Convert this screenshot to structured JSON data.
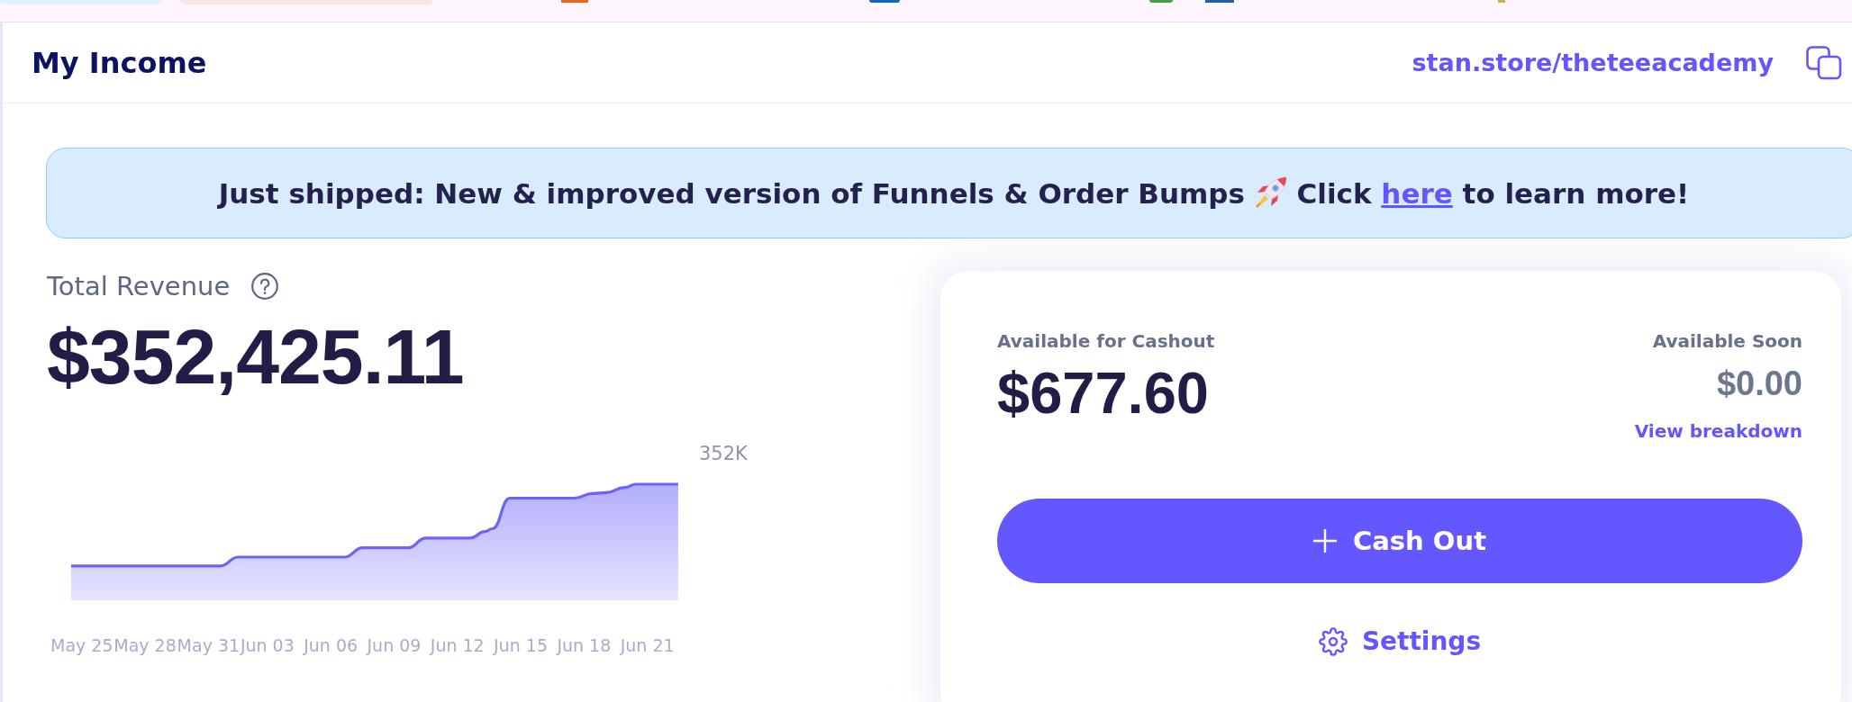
{
  "header": {
    "title": "My Income",
    "store_link": "stan.store/theteeacademy"
  },
  "announcement": {
    "text_before": "Just shipped: New & improved version of Funnels & Order Bumps",
    "text_middle": "Click",
    "link": "here",
    "text_after": "to learn more!"
  },
  "revenue": {
    "label": "Total Revenue",
    "amount": "$352,425.11",
    "chart": {
      "y_label": "352K",
      "x_labels": [
        "May 25",
        "May 28",
        "May 31",
        "Jun 03",
        "Jun 06",
        "Jun 09",
        "Jun 12",
        "Jun 15",
        "Jun 18",
        "Jun 21"
      ]
    }
  },
  "cashout": {
    "available_label": "Available for Cashout",
    "available_amount": "$677.60",
    "soon_label": "Available Soon",
    "soon_amount": "$0.00",
    "breakdown_link": "View breakdown",
    "button": "Cash Out",
    "settings": "Settings"
  }
}
